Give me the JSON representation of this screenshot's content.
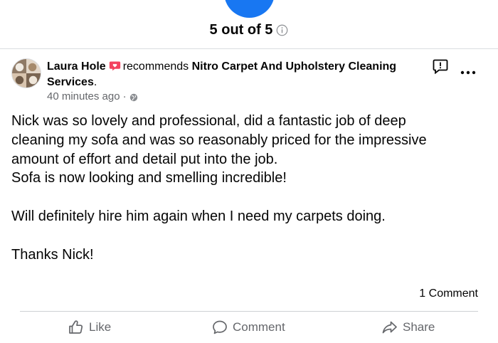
{
  "rating": {
    "text": "5 out of 5"
  },
  "post": {
    "author": "Laura Hole",
    "recommends_word": "recommends",
    "page_name": "Nitro Carpet And Upholstery Cleaning Services",
    "page_suffix": ".",
    "timestamp": "40 minutes ago",
    "separator": "·",
    "body": {
      "line1": "Nick was so lovely and professional, did a fantastic job of deep",
      "line2": "cleaning my sofa and was so reasonably priced for the impressive",
      "line3": "amount of effort and detail put into the job.",
      "line4": "Sofa is now looking and smelling incredible!",
      "line5": "Will definitely hire him again when I need my carpets doing.",
      "line6": "Thanks Nick!"
    },
    "comment_count": "1 Comment"
  },
  "actions": {
    "like": "Like",
    "comment": "Comment",
    "share": "Share"
  },
  "colors": {
    "accent": "#1877f2",
    "recommend_icon": "#f3425f",
    "secondary_text": "#65676b",
    "divider": "#dadde1"
  },
  "icons": {
    "rating_badge": "rating-circle-icon",
    "info": "info-icon",
    "recommend": "recommend-speech-bubble-icon",
    "globe": "globe-icon",
    "report": "report-flag-icon",
    "more": "more-options-icon",
    "like": "thumbs-up-icon",
    "comment": "comment-bubble-icon",
    "share": "share-arrow-icon"
  }
}
